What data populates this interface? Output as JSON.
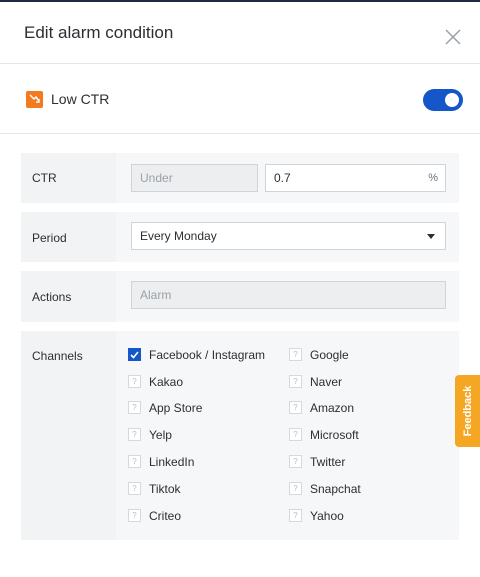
{
  "header": {
    "title": "Edit alarm condition"
  },
  "alarm": {
    "name": "Low CTR",
    "enabled": true,
    "icon": "trend-down-icon",
    "icon_color": "#f47a20"
  },
  "fields": {
    "ctr": {
      "label": "CTR",
      "operator": "Under",
      "value": "0.7",
      "unit": "%"
    },
    "period": {
      "label": "Period",
      "value": "Every Monday"
    },
    "actions": {
      "label": "Actions",
      "value": "Alarm"
    },
    "channels": {
      "label": "Channels",
      "left": [
        {
          "name": "Facebook / Instagram",
          "checked": true
        },
        {
          "name": "Kakao",
          "checked": false
        },
        {
          "name": "App Store",
          "checked": false
        },
        {
          "name": "Yelp",
          "checked": false
        },
        {
          "name": "LinkedIn",
          "checked": false
        },
        {
          "name": "Tiktok",
          "checked": false
        },
        {
          "name": "Criteo",
          "checked": false
        }
      ],
      "right": [
        {
          "name": "Google",
          "checked": false
        },
        {
          "name": "Naver",
          "checked": false
        },
        {
          "name": "Amazon",
          "checked": false
        },
        {
          "name": "Microsoft",
          "checked": false
        },
        {
          "name": "Twitter",
          "checked": false
        },
        {
          "name": "Snapchat",
          "checked": false
        },
        {
          "name": "Yahoo",
          "checked": false
        }
      ]
    }
  },
  "feedback": {
    "label": "Feedback"
  },
  "colors": {
    "accent": "#1457c8",
    "feedback": "#f5a623",
    "alarm_icon": "#f47a20"
  }
}
